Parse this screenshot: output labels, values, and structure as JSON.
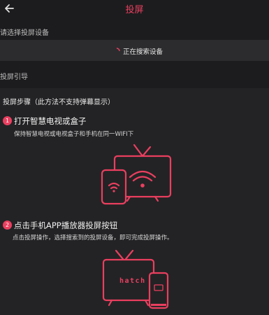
{
  "header": {
    "title": "投屏"
  },
  "select_device": {
    "label": "请选择投屏设备",
    "status": "正在搜索设备"
  },
  "guide": {
    "label": "投屏引导",
    "steps_heading": "投屏步骤（此方法不支持弹幕显示）",
    "steps": [
      {
        "num": "1",
        "title": "打开智慧电视或盒子",
        "desc": "保持智慧电视或电视盒子和手机在同一WIFI下"
      },
      {
        "num": "2",
        "title": "点击手机APP播放器投屏按钮",
        "desc": "点击投屏操作，选择搜索到的投屏设备，即可完成投屏操作。"
      }
    ]
  },
  "illustration": {
    "tv_text": "hatch"
  },
  "colors": {
    "accent": "#ea3f5f",
    "background": "#1c1c1e",
    "panel": "#2c2c2e"
  }
}
